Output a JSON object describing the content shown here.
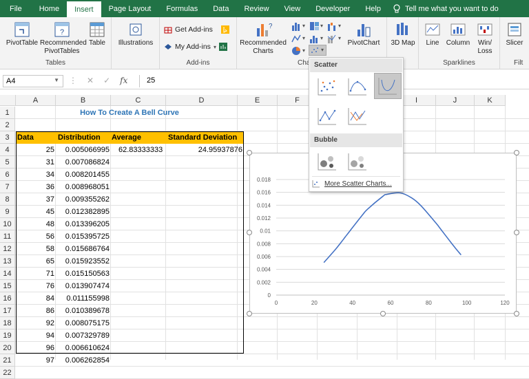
{
  "menu": {
    "tabs": [
      "File",
      "Home",
      "Insert",
      "Page Layout",
      "Formulas",
      "Data",
      "Review",
      "View",
      "Developer",
      "Help"
    ],
    "active": "Insert",
    "tell_me": "Tell me what you want to do"
  },
  "ribbon": {
    "pivottable": "PivotTable",
    "recommended_pivot": "Recommended PivotTables",
    "table": "Table",
    "tables_group": "Tables",
    "illustrations": "Illustrations",
    "get_addins": "Get Add-ins",
    "my_addins": "My Add-ins",
    "addins_group": "Add-ins",
    "recommended_charts": "Recommended Charts",
    "pivotchart": "PivotChart",
    "charts_group": "Cha",
    "map3d": "3D Map",
    "sparkline_line": "Line",
    "sparkline_column": "Column",
    "sparkline_winloss": "Win/ Loss",
    "sparklines_group": "Sparklines",
    "slicer": "Slicer",
    "filters_group": "Filt"
  },
  "formula_bar": {
    "name_box": "A4",
    "fx": "fx",
    "formula": "25"
  },
  "columns": [
    "A",
    "B",
    "C",
    "D",
    "E",
    "F",
    "G",
    "H",
    "I",
    "J",
    "K"
  ],
  "rows": [
    "1",
    "2",
    "3",
    "4",
    "5",
    "6",
    "7",
    "8",
    "9",
    "10",
    "11",
    "12",
    "13",
    "14",
    "15",
    "16",
    "17",
    "18",
    "19",
    "20",
    "21",
    "22"
  ],
  "sheet": {
    "title": "How To Create A Bell Curve",
    "headers": [
      "Data",
      "Distribution",
      "Average",
      "Standard Deviation"
    ],
    "average": "62.83333333",
    "stdev": "24.95937876",
    "data": [
      [
        "25",
        "0.005066995"
      ],
      [
        "31",
        "0.007086824"
      ],
      [
        "34",
        "0.008201455"
      ],
      [
        "36",
        "0.008968051"
      ],
      [
        "37",
        "0.009355262"
      ],
      [
        "45",
        "0.012382895"
      ],
      [
        "48",
        "0.013396205"
      ],
      [
        "56",
        "0.015395725"
      ],
      [
        "58",
        "0.015686764"
      ],
      [
        "65",
        "0.015923552"
      ],
      [
        "71",
        "0.015150563"
      ],
      [
        "76",
        "0.013907474"
      ],
      [
        "84",
        "0.011155998"
      ],
      [
        "86",
        "0.010389678"
      ],
      [
        "92",
        "0.008075175"
      ],
      [
        "94",
        "0.007329789"
      ],
      [
        "96",
        "0.006610624"
      ],
      [
        "97",
        "0.006262854"
      ]
    ]
  },
  "dropdown": {
    "scatter_label": "Scatter",
    "bubble_label": "Bubble",
    "more": "More Scatter Charts..."
  },
  "chart_data": {
    "type": "scatter",
    "series": [
      {
        "x": [
          25,
          31,
          34,
          36,
          37,
          45,
          48,
          56,
          58,
          65,
          71,
          76,
          84,
          86,
          92,
          94,
          96,
          97
        ],
        "y": [
          0.005066995,
          0.007086824,
          0.008201455,
          0.008968051,
          0.009355262,
          0.012382895,
          0.013396205,
          0.015395725,
          0.015686764,
          0.015923552,
          0.015150563,
          0.013907474,
          0.011155998,
          0.010389678,
          0.008075175,
          0.007329789,
          0.006610624,
          0.006262854
        ]
      }
    ],
    "xlim": [
      0,
      120
    ],
    "ylim": [
      0,
      0.018
    ],
    "xticks": [
      "0",
      "20",
      "40",
      "60",
      "80",
      "100",
      "120"
    ],
    "yticks": [
      "0",
      "0.002",
      "0.004",
      "0.006",
      "0.008",
      "0.01",
      "0.012",
      "0.014",
      "0.016",
      "0.018"
    ],
    "line_color": "#4472c4",
    "smooth": true,
    "grid": "horizontal"
  }
}
